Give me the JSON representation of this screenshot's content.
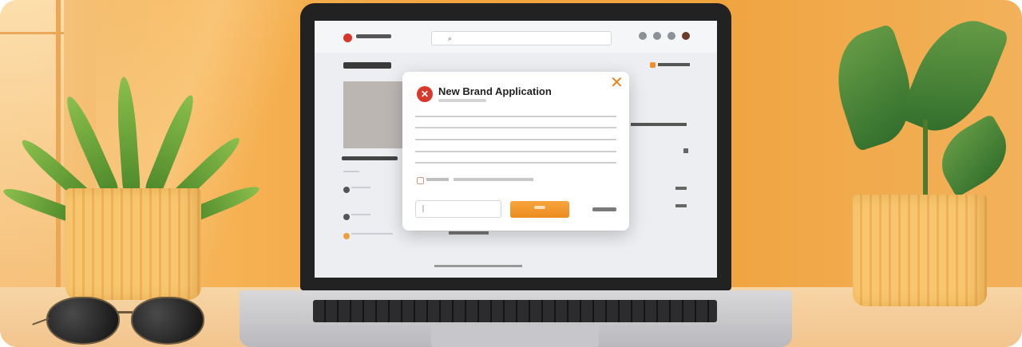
{
  "modal": {
    "title": "New Brand Application",
    "close_symbol": "✕",
    "icon_glyph": "✕"
  },
  "colors": {
    "accent_orange": "#ee8c1f",
    "brand_red": "#d73a2c",
    "wall": "#f3a43f"
  },
  "icons": {
    "close": "close-icon",
    "brand": "brand-logo-icon",
    "search": "search-icon"
  }
}
